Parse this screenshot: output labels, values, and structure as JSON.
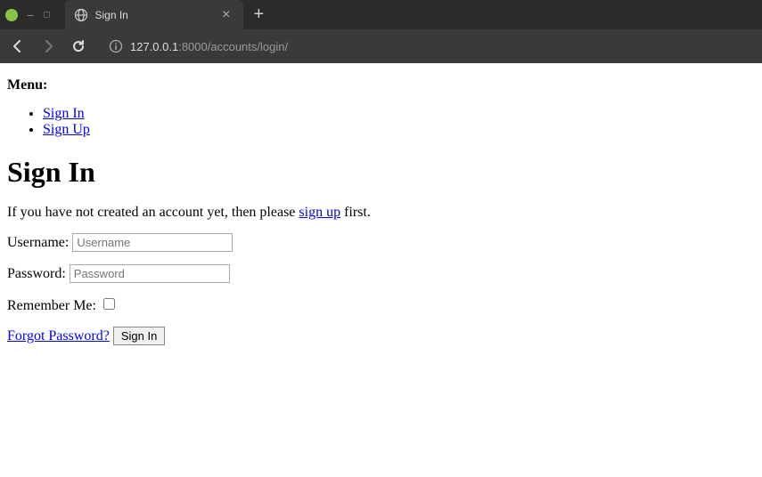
{
  "browser": {
    "tab_title": "Sign In",
    "url_host": "127.0.0.1",
    "url_path": ":8000/accounts/login/",
    "new_tab_symbol": "+",
    "tab_close_symbol": "×"
  },
  "page": {
    "menu_label": "Menu:",
    "menu_items": [
      {
        "label": "Sign In"
      },
      {
        "label": "Sign Up"
      }
    ],
    "heading": "Sign In",
    "intro_prefix": "If you have not created an account yet, then please ",
    "intro_link": "sign up",
    "intro_suffix": " first.",
    "username_label": "Username: ",
    "username_placeholder": "Username",
    "password_label": "Password: ",
    "password_placeholder": "Password",
    "remember_label": "Remember Me: ",
    "forgot_link": "Forgot Password?",
    "submit_label": "Sign In"
  }
}
